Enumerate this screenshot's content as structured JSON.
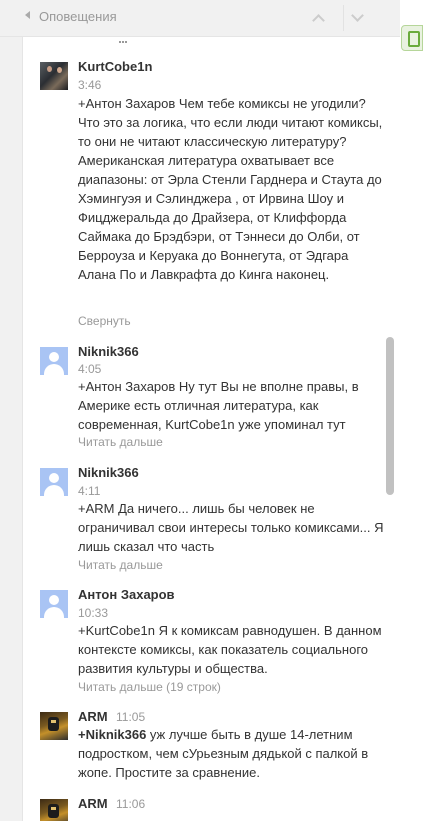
{
  "header": {
    "title": "Оповещения"
  },
  "comments": [
    {
      "author": "KurtCobe1n",
      "time": "3:46",
      "text": "+Антон Захаров Чем тебе комиксы не угодили? Что это за логика, что если люди читают комиксы, то они не читают классическую литературу?\nАмериканская литература охватывает все диапазоны: от Эрла Стенли Гарднера и Стаута до Хэмингуэя и Сэлинджера , от Ирвина Шоу и Фицджеральда до Драйзера, от Клиффорда Саймака до Брэдбэри, от Тэннеси до Олби, от Берроуза и Керуака до Воннегута, от Эдгара Алана По и Лавкрафта до Кинга наконец.",
      "action": "Свернуть"
    },
    {
      "author": "Niknik366",
      "time": "4:05",
      "text": "+Антон Захаров Ну тут Вы не вполне правы, в Америке есть отличная литература, как современная, KurtCobe1n уже упоминал тут",
      "action": "Читать дальше"
    },
    {
      "author": "Niknik366",
      "time": "4:11",
      "text": "+ARM Да ничего... лишь бы человек не ограничивал свои интересы только комиксами... Я лишь сказал что часть",
      "action": "Читать дальше"
    },
    {
      "author": "Антон Захаров",
      "time": "10:33",
      "text": "+KurtCobe1n Я к комиксам равнодушен. В данном контексте комиксы, как показатель социального развития культуры и общества.",
      "action": "Читать дальше (19 строк)"
    },
    {
      "author": "ARM",
      "time": "11:05",
      "mention": "+Niknik366",
      "text": " уж лучше быть в душе 14-летним подростком, чем сУрьезным дядькой с палкой в жопе. Простите за сравнение."
    },
    {
      "author": "ARM",
      "time": "11:06"
    }
  ]
}
